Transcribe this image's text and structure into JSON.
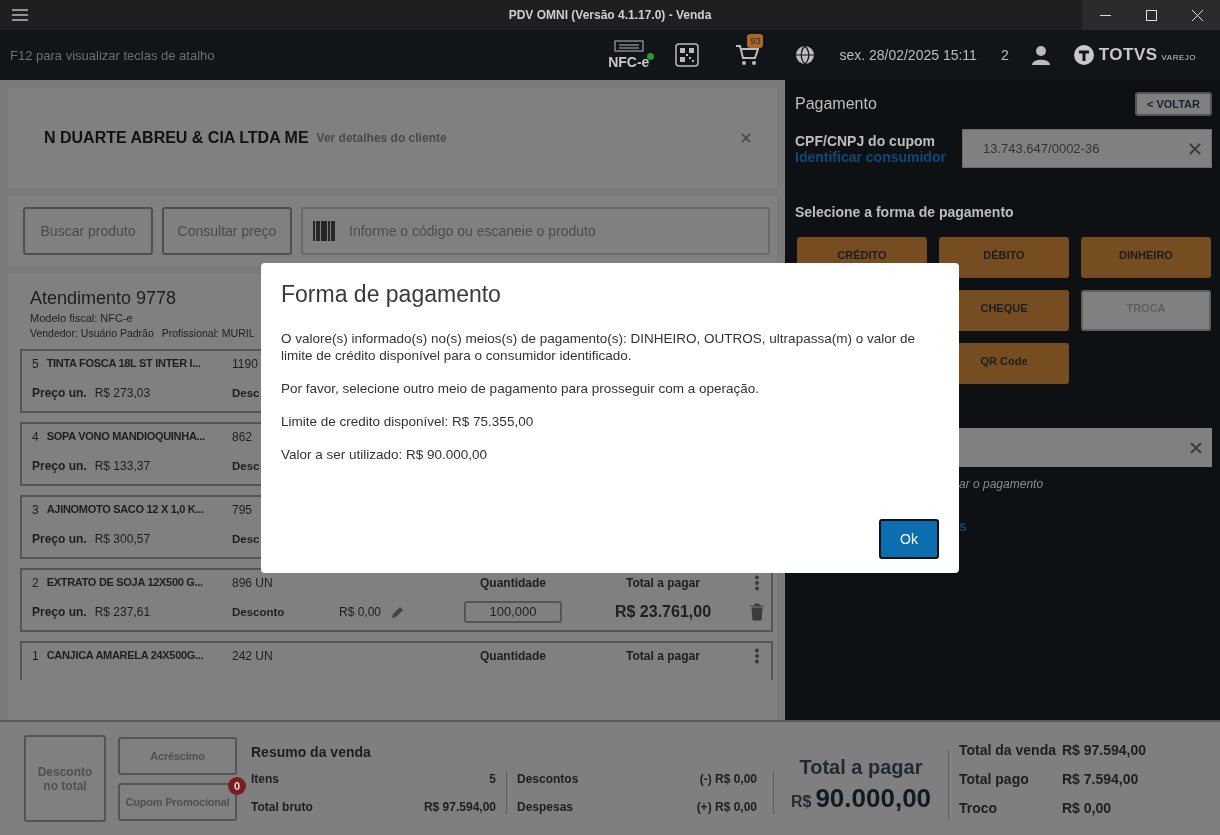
{
  "window": {
    "title": "PDV OMNI (Versão 4.1.17.0) - Venda"
  },
  "header": {
    "shortcut_hint": "F12 para visualizar teclas de atalho",
    "fiscal_model": "NFC-e",
    "fiscal_online": true,
    "cart_count": "93",
    "datetime": "sex. 28/02/2025 15:11",
    "terminal": "2",
    "brand": "TOTVS",
    "brand_sub": "VAREJO"
  },
  "customer": {
    "name": "N DUARTE ABREU & CIA LTDA ME",
    "details_link": "Ver detalhes do cliente"
  },
  "toolbar": {
    "buttons": [
      "Buscar produto",
      "Consultar preço"
    ],
    "product_field": {
      "placeholder": "Informe o código ou escaneie o produto"
    }
  },
  "sale": {
    "title": "Atendimento 9778",
    "fiscal_model": "Modelo fiscal: NFC-e",
    "seller": "Vendedor: Usuário Padrão",
    "professional": "Profissional: MURIL"
  },
  "items": [
    {
      "number": "5",
      "name": "TINTA FOSCA 18L ST INTER I...",
      "quantity_unit": "1190",
      "price_label": "Preço un.",
      "price": "R$ 273,03",
      "discount_label": "Desc"
    },
    {
      "number": "4",
      "name": "SOPA VONO MANDIOQUINHA...",
      "quantity_unit": "862",
      "price_label": "Preço un.",
      "price": "R$ 133,37",
      "discount_label": "Desc"
    },
    {
      "number": "3",
      "name": "AJINOMOTO SACO 12 X 1,0 K...",
      "quantity_unit": "795",
      "price_label": "Preço un.",
      "price": "R$ 300,57",
      "discount_label": "Desc"
    },
    {
      "number": "2",
      "name": "EXTRATO DE SOJA 12X500 G...",
      "quantity_unit": "896 UN",
      "price_label": "Preço un.",
      "price": "R$ 237,61",
      "discount_label": "Desconto",
      "discount": "R$ 0,00",
      "quantity_label": "Quantidade",
      "quantity": "100,000",
      "total_label": "Total a pagar",
      "total": "R$ 23.761,00"
    },
    {
      "number": "1",
      "name": "CANJICA AMARELA 24X500G...",
      "quantity_unit": "242 UN",
      "quantity_label": "Quantidade",
      "total_label": "Total a pagar"
    }
  ],
  "payment": {
    "title": "Pagamento",
    "back_button": "< VOLTAR",
    "document_label": "CPF/CNPJ do cupom",
    "identify_link": "Identificar consumidor",
    "document_value": "13.743.647/0002-36",
    "methods_title": "Selecione a forma de pagamento",
    "methods": [
      {
        "label": "CRÉDITO",
        "disabled": false
      },
      {
        "label": "DÉBITO",
        "disabled": false
      },
      {
        "label": "DINHEIRO",
        "disabled": false
      },
      {
        "label": "CHEQUE",
        "disabled": false
      },
      {
        "label": "TROCA",
        "disabled": true
      },
      {
        "label": "QR Code",
        "disabled": false
      }
    ],
    "amount_field": {
      "clearable": true
    },
    "amount_hint": "ar o pagamento",
    "link_fragment": "s"
  },
  "dialog": {
    "title": "Forma de pagamento",
    "paragraphs": [
      "O valore(s) informado(s) no(s) meios(s) de pagamento(s): DINHEIRO, OUTROS, ultrapassa(m) o valor de limite de crédito disponível para o consumidor identificado.",
      "Por favor, selecione outro meio de pagamento para prosseguir com a operação.",
      "Limite de credito disponível: R$ 75.355,00",
      "Valor a ser utilizado: R$ 90.000,00"
    ],
    "ok_button": "Ok"
  },
  "summary": {
    "discount_button": "Desconto no total",
    "surcharge_button": "Acréscimo",
    "coupon_button": "Cupom Promocional",
    "coupon_count": "0",
    "title": "Resumo da venda",
    "left_rows": [
      {
        "label": "Itens",
        "value": "5"
      },
      {
        "label": "Total bruto",
        "value": "R$ 97.594,00"
      }
    ],
    "right_rows": [
      {
        "label": "Descontos",
        "value": "(-) R$ 0,00"
      },
      {
        "label": "Despesas",
        "value": "(+) R$ 0,00"
      }
    ],
    "total_label": "Total a pagar",
    "total_currency": "R$",
    "total_value": "90.000,00",
    "totals": [
      {
        "label": "Total da venda",
        "value": "R$ 97.594,00"
      },
      {
        "label": "Total pago",
        "value": "R$ 7.594,00"
      },
      {
        "label": "Troco",
        "value": "R$ 0,00"
      }
    ]
  }
}
